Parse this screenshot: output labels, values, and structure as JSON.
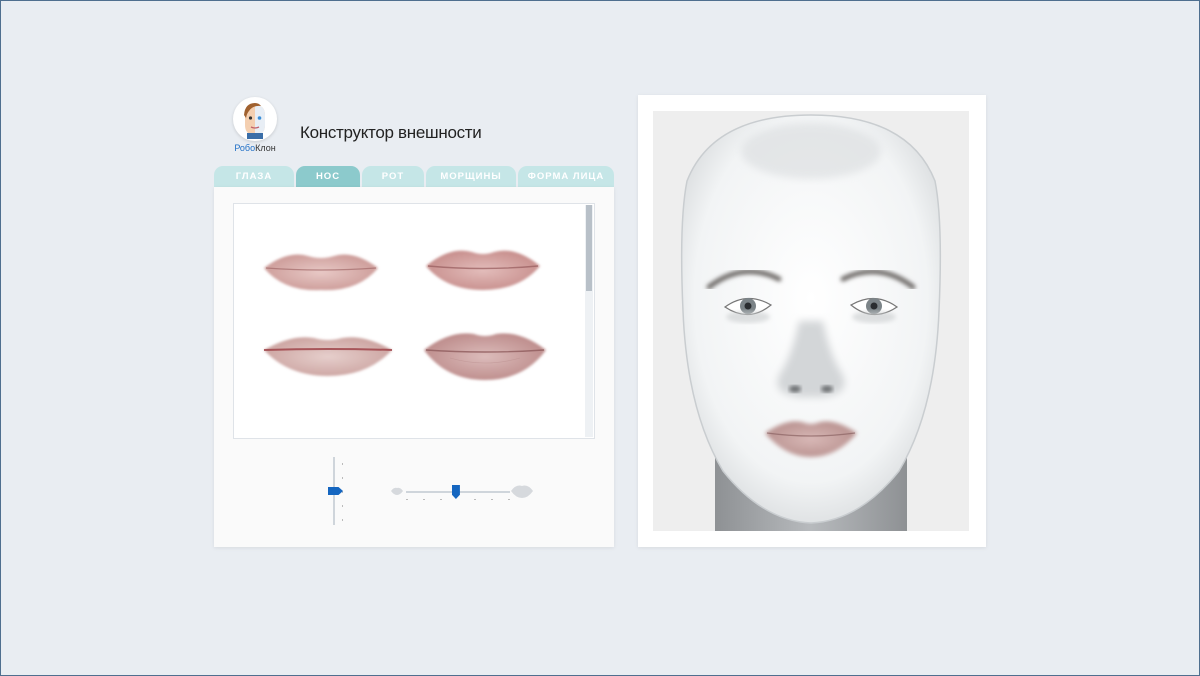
{
  "logo": {
    "part1": "Робо",
    "part2": "Клон",
    "icon": "robot-face-icon"
  },
  "header": {
    "title": "Конструктор внешности"
  },
  "tabs": [
    {
      "label": "ГЛАЗА",
      "active": false
    },
    {
      "label": "НОС",
      "active": true
    },
    {
      "label": "РОТ",
      "active": false
    },
    {
      "label": "МОРЩИНЫ",
      "active": false
    },
    {
      "label": "ФОРМА ЛИЦА",
      "active": false
    }
  ],
  "variants": [
    {
      "name": "lips-variant-1"
    },
    {
      "name": "lips-variant-2"
    },
    {
      "name": "lips-variant-3"
    },
    {
      "name": "lips-variant-4"
    }
  ],
  "sliders": {
    "vertical_level": 0.5,
    "horizontal_level": 0.48
  },
  "colors": {
    "tab": "#c5e6e7",
    "tab_active": "#8ccacc",
    "accent": "#1566c0",
    "background": "#e9edf2"
  }
}
